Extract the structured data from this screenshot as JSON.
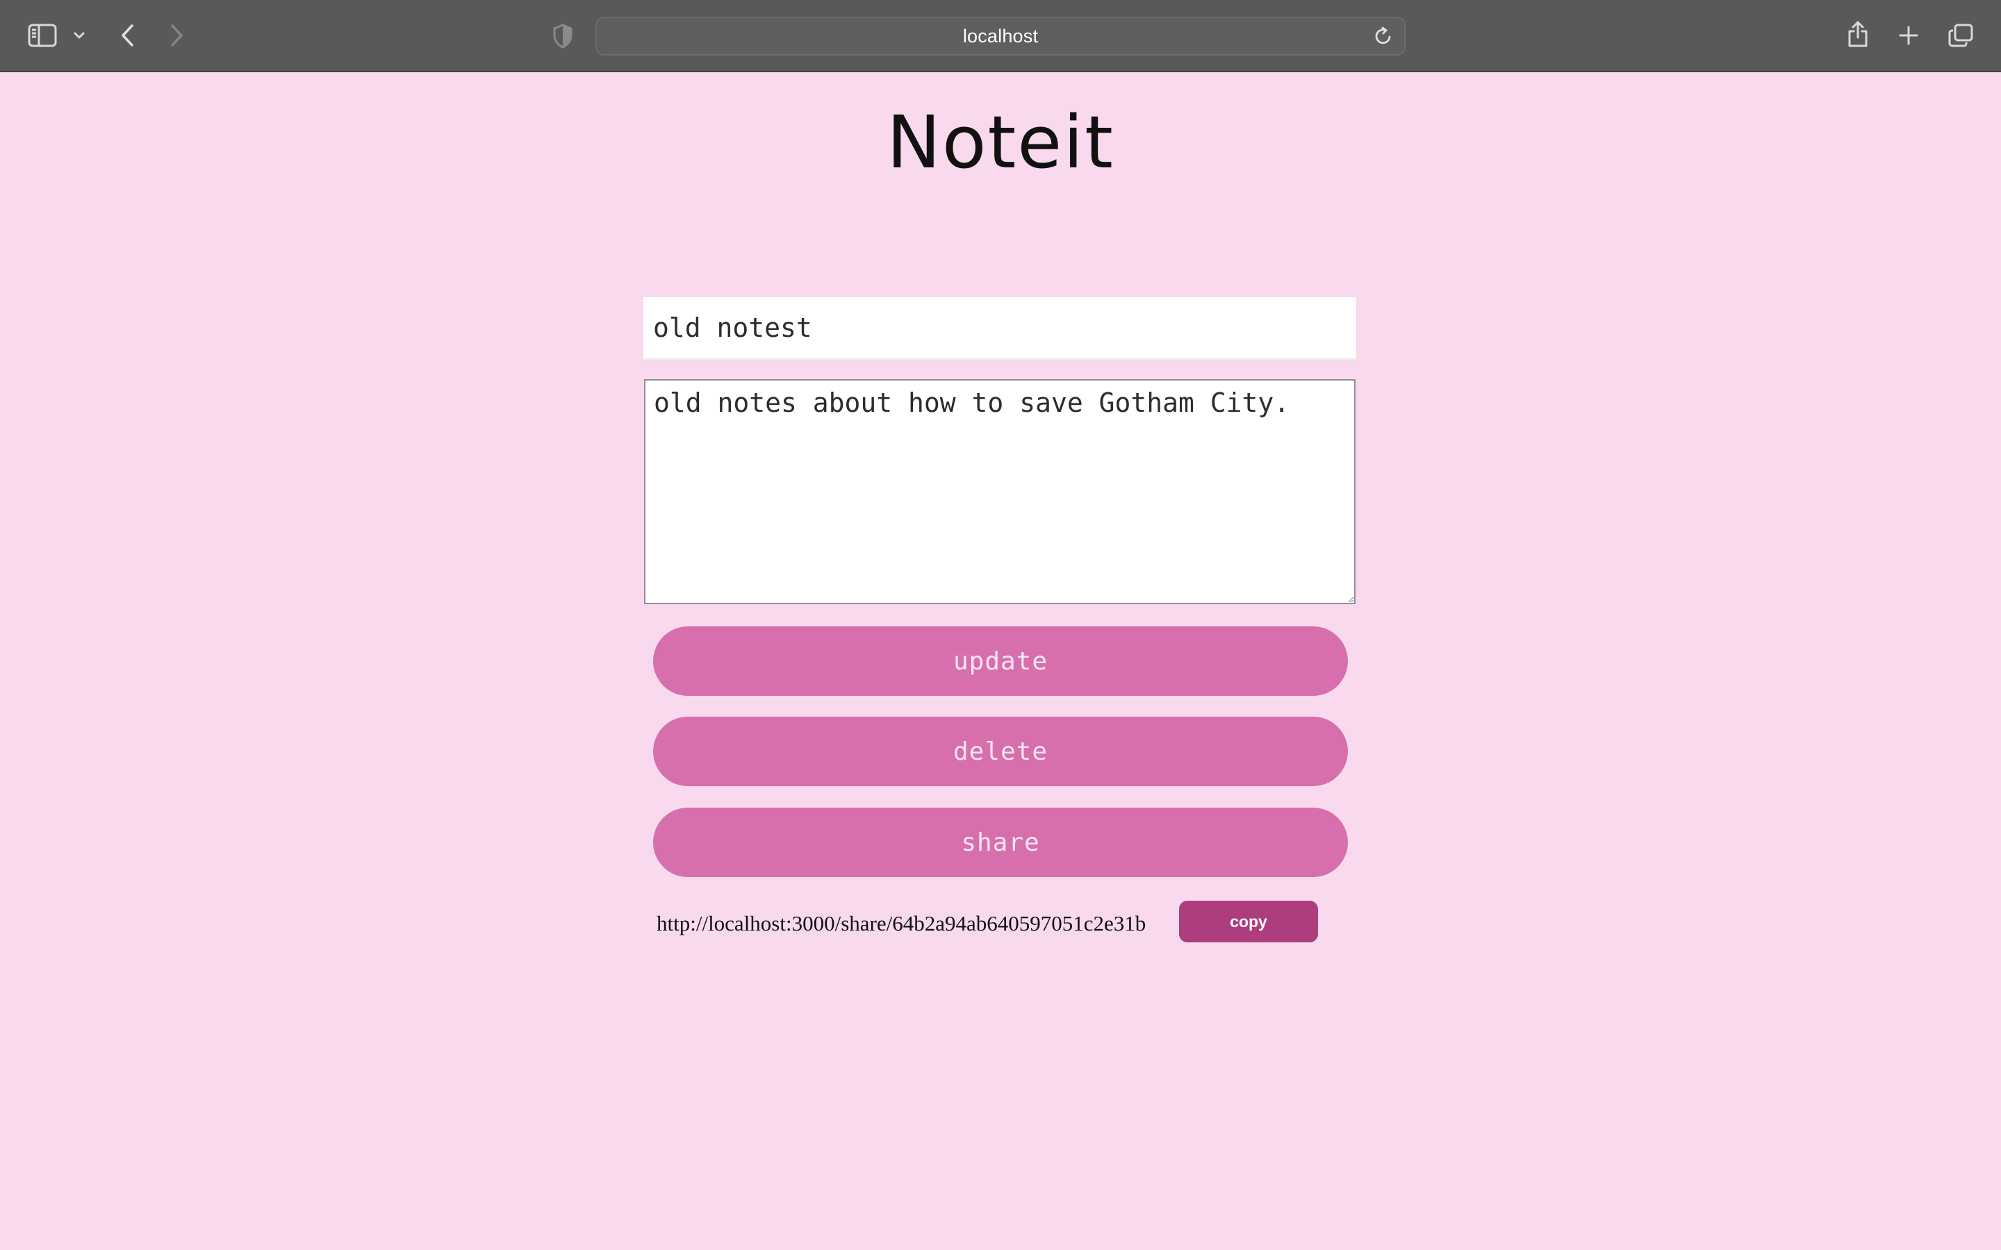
{
  "browser": {
    "address": "localhost",
    "icons": {
      "sidebar": "sidebar-icon",
      "sidebar_menu": "chevron-down-icon",
      "back": "chevron-left-icon",
      "forward": "chevron-right-icon",
      "privacy": "shield-icon",
      "reload": "reload-icon",
      "share": "share-icon",
      "new_tab": "plus-icon",
      "tab_overview": "tabs-icon"
    }
  },
  "app": {
    "title": "Noteit"
  },
  "note": {
    "title_value": "old notest",
    "body_value": "old notes about how to save Gotham City."
  },
  "actions": {
    "update_label": "update",
    "delete_label": "delete",
    "share_label": "share"
  },
  "share": {
    "link": "http://localhost:3000/share/64b2a94ab640597051c2e31b",
    "copy_label": "copy"
  },
  "colors": {
    "page_background": "#f8d9ee",
    "button": "#d76fad",
    "copy_button": "#ad3d7d",
    "toolbar": "#595959"
  }
}
